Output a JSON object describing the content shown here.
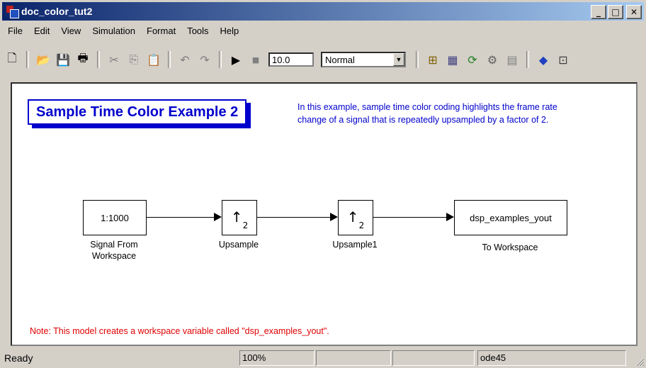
{
  "window": {
    "title": "doc_color_tut2"
  },
  "menu": [
    "File",
    "Edit",
    "View",
    "Simulation",
    "Format",
    "Tools",
    "Help"
  ],
  "toolbar": {
    "stop_time": "10.0",
    "sim_mode": "Normal",
    "icons": [
      "new-icon",
      "open-icon",
      "save-icon",
      "print-icon",
      "cut-icon",
      "copy-icon",
      "paste-icon",
      "undo-icon",
      "redo-icon",
      "start-icon",
      "stop-icon"
    ]
  },
  "canvas": {
    "title": "Sample Time Color Example 2",
    "description": [
      "In this example, sample time color coding highlights the frame rate",
      "change of a signal that is repeatedly upsampled by a factor of 2."
    ],
    "blocks": {
      "signal": {
        "content": "1:1000",
        "label_line1": "Signal From",
        "label_line2": "Workspace"
      },
      "upsample": {
        "arrow": "↑",
        "factor": "2",
        "label": "Upsample"
      },
      "upsample1": {
        "arrow": "↑",
        "factor": "2",
        "label": "Upsample1"
      },
      "workspace": {
        "content": "dsp_examples_yout",
        "label": "To Workspace"
      }
    },
    "note": "Note: This model creates a workspace variable called \"dsp_examples_yout\"."
  },
  "status": {
    "state": "Ready",
    "zoom": "100%",
    "solver": "ode45"
  },
  "colors": {
    "annotation_blue": "#0000cc",
    "note_red": "#e00000",
    "title_bar": "#0a246a"
  }
}
